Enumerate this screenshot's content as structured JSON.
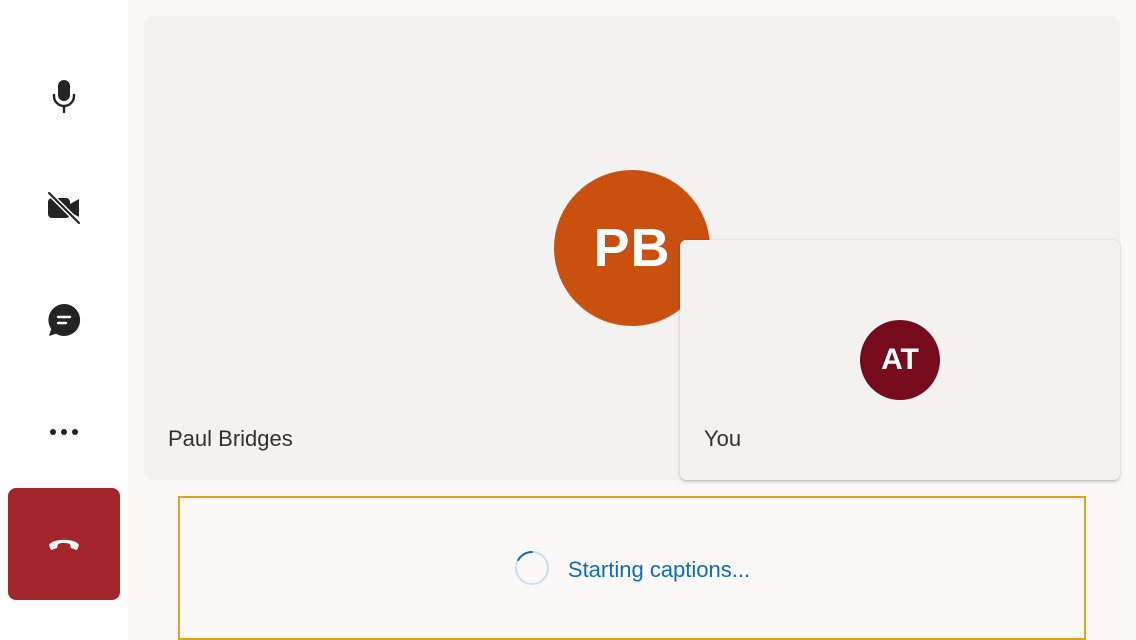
{
  "sidebar": {
    "buttons": [
      {
        "icon": "microphone-icon",
        "label": "Microphone"
      },
      {
        "icon": "camera-off-icon",
        "label": "Camera off"
      },
      {
        "icon": "chat-icon",
        "label": "Chat"
      },
      {
        "icon": "more-icon",
        "label": "More"
      },
      {
        "icon": "hang-up-icon",
        "label": "Hang up"
      }
    ]
  },
  "stage": {
    "remote": {
      "initials": "PB",
      "name": "Paul Bridges",
      "avatar_color": "#ca5010"
    },
    "self": {
      "initials": "AT",
      "name": "You",
      "avatar_color": "#750b1c"
    }
  },
  "captions": {
    "status": "Starting captions...",
    "border_color": "#e3a21a",
    "text_color": "#0f6cbd"
  },
  "colors": {
    "hangup": "#a4262c",
    "icon": "#242424"
  }
}
